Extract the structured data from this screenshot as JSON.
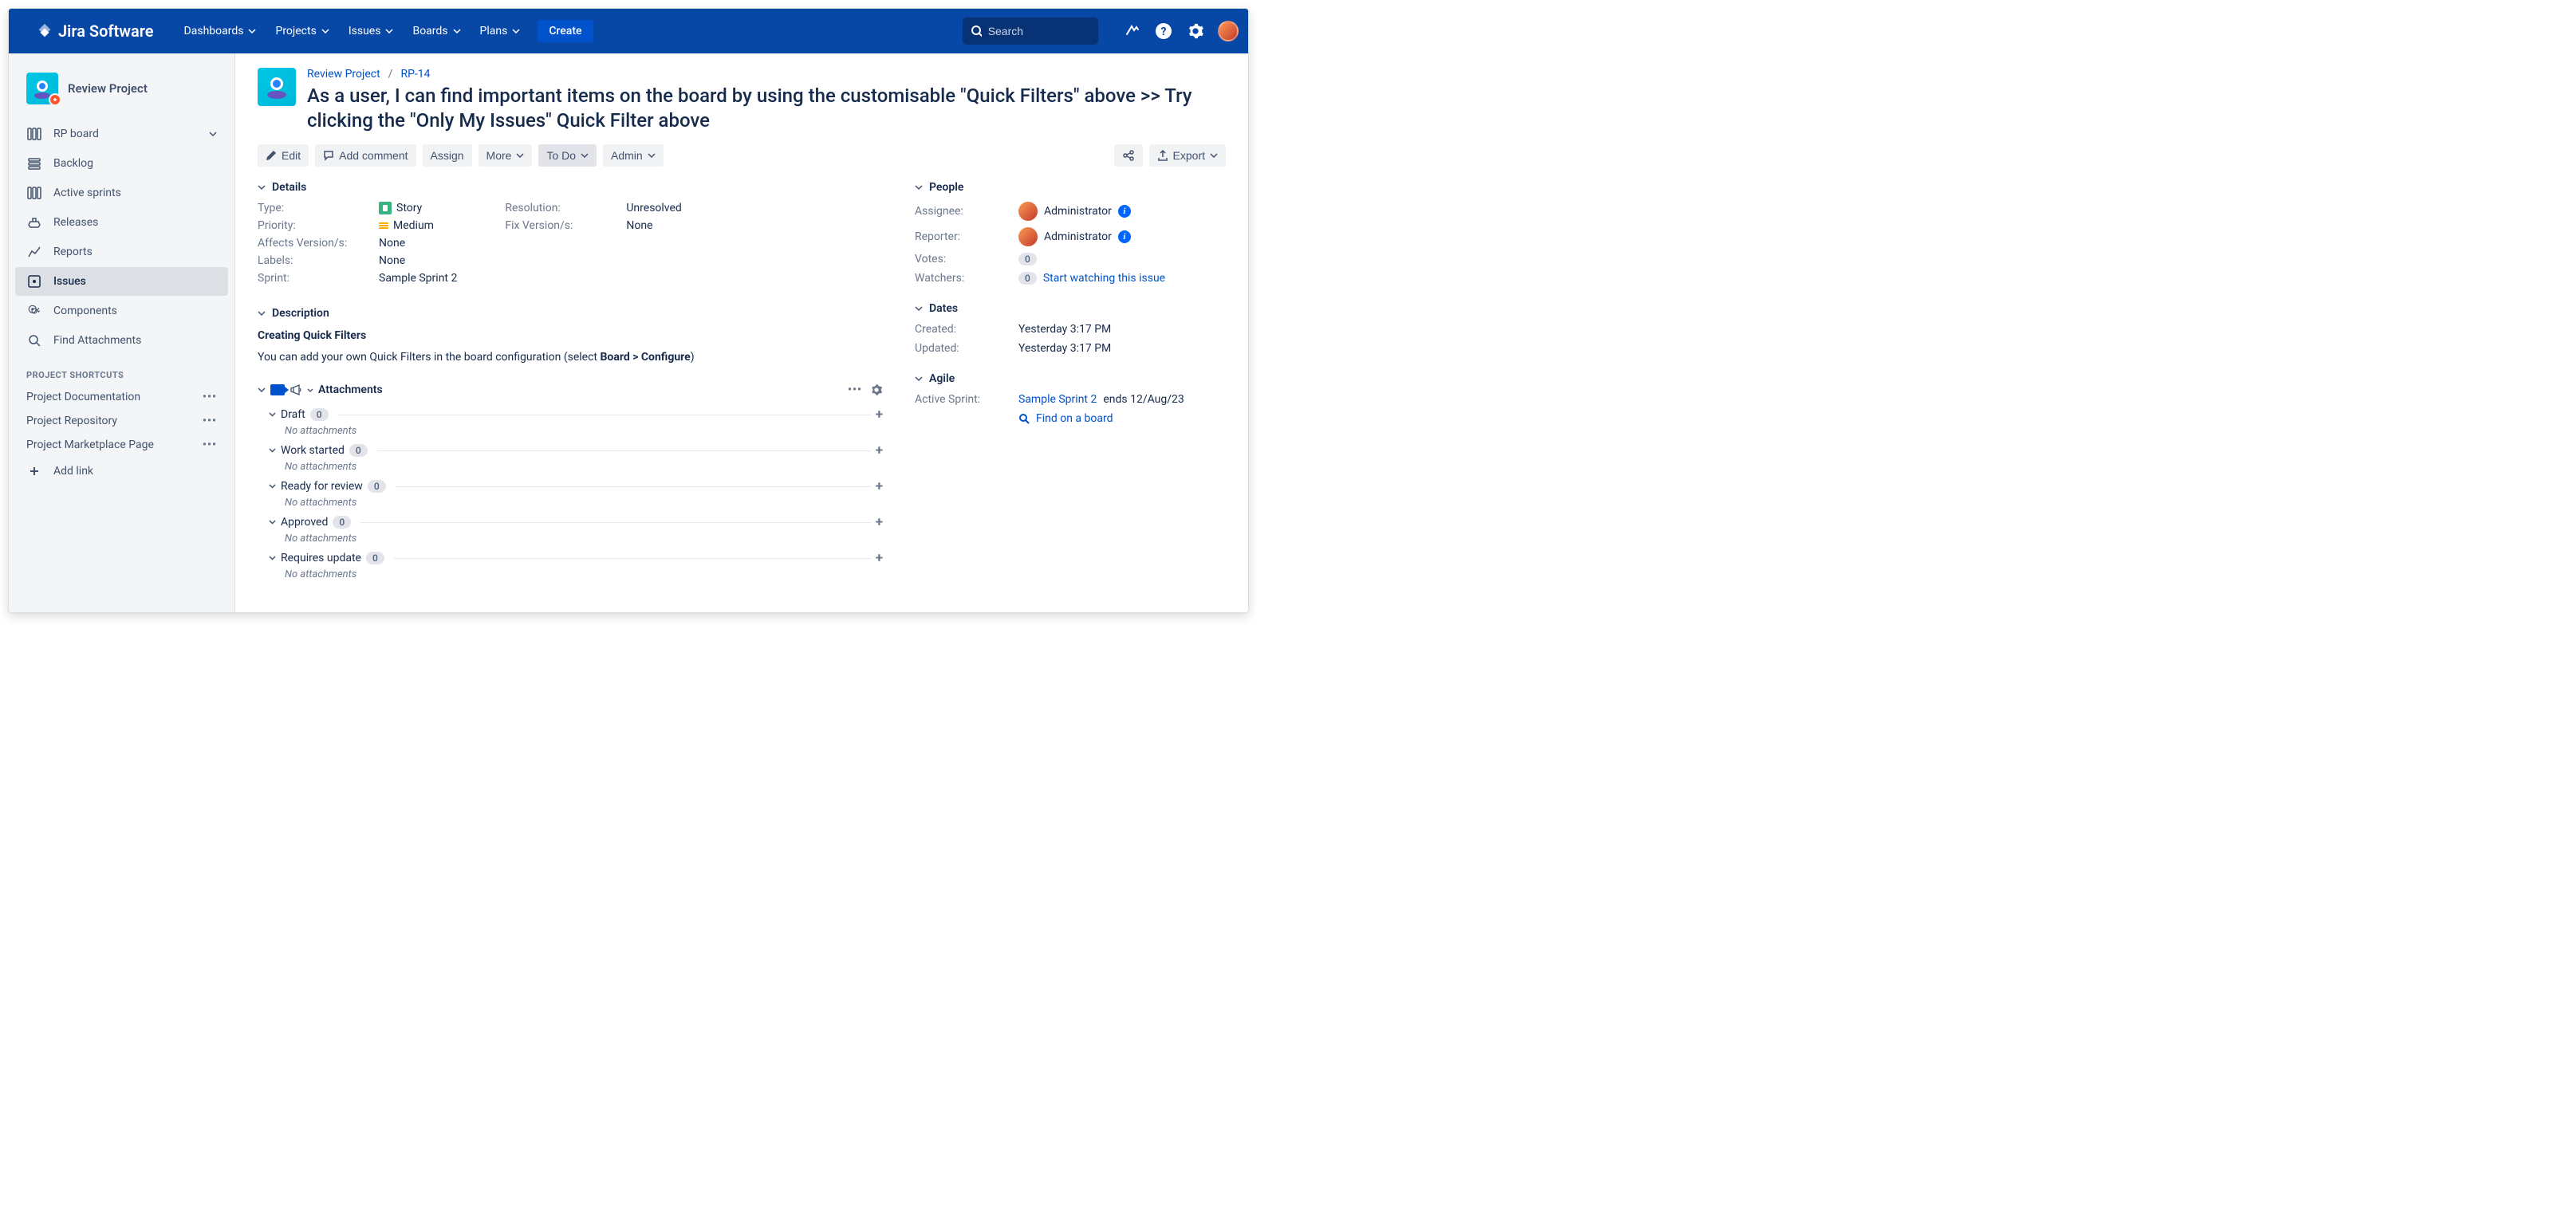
{
  "nav": {
    "logo": "Jira Software",
    "items": [
      "Dashboards",
      "Projects",
      "Issues",
      "Boards",
      "Plans"
    ],
    "create": "Create",
    "search_placeholder": "Search"
  },
  "sidebar": {
    "project_name": "Review Project",
    "items": [
      {
        "label": "RP board",
        "icon": "board",
        "expandable": true
      },
      {
        "label": "Backlog",
        "icon": "backlog"
      },
      {
        "label": "Active sprints",
        "icon": "sprints"
      },
      {
        "label": "Releases",
        "icon": "ship"
      },
      {
        "label": "Reports",
        "icon": "chart"
      },
      {
        "label": "Issues",
        "icon": "issues",
        "active": true
      },
      {
        "label": "Components",
        "icon": "component"
      },
      {
        "label": "Find Attachments",
        "icon": "search"
      }
    ],
    "shortcuts_heading": "PROJECT SHORTCUTS",
    "shortcuts": [
      "Project Documentation",
      "Project Repository",
      "Project Marketplace Page"
    ],
    "add_link": "Add link"
  },
  "issue": {
    "breadcrumb_project": "Review Project",
    "breadcrumb_key": "RP-14",
    "summary": "As a user, I can find important items on the board by using the customisable \"Quick Filters\" above >> Try clicking the \"Only My Issues\" Quick Filter above"
  },
  "toolbar": {
    "edit": "Edit",
    "comment": "Add comment",
    "assign": "Assign",
    "more": "More",
    "status": "To Do",
    "admin": "Admin",
    "export": "Export"
  },
  "details": {
    "title": "Details",
    "type_label": "Type:",
    "type_value": "Story",
    "priority_label": "Priority:",
    "priority_value": "Medium",
    "affects_label": "Affects Version/s:",
    "affects_value": "None",
    "labels_label": "Labels:",
    "labels_value": "None",
    "sprint_label": "Sprint:",
    "sprint_value": "Sample Sprint 2",
    "resolution_label": "Resolution:",
    "resolution_value": "Unresolved",
    "fix_label": "Fix Version/s:",
    "fix_value": "None"
  },
  "description": {
    "title": "Description",
    "heading": "Creating Quick Filters",
    "text_before": "You can add your own Quick Filters in the board configuration (select ",
    "text_bold": "Board > Configure",
    "text_after": ")"
  },
  "attachments": {
    "title": "Attachments",
    "sections": [
      {
        "name": "Draft",
        "count": "0",
        "empty": "No attachments"
      },
      {
        "name": "Work started",
        "count": "0",
        "empty": "No attachments"
      },
      {
        "name": "Ready for review",
        "count": "0",
        "empty": "No attachments"
      },
      {
        "name": "Approved",
        "count": "0",
        "empty": "No attachments"
      },
      {
        "name": "Requires update",
        "count": "0",
        "empty": "No attachments"
      }
    ]
  },
  "people": {
    "title": "People",
    "assignee_label": "Assignee:",
    "assignee_value": "Administrator",
    "reporter_label": "Reporter:",
    "reporter_value": "Administrator",
    "votes_label": "Votes:",
    "votes_value": "0",
    "watchers_label": "Watchers:",
    "watchers_value": "0",
    "watch_link": "Start watching this issue"
  },
  "dates": {
    "title": "Dates",
    "created_label": "Created:",
    "created_value": "Yesterday 3:17 PM",
    "updated_label": "Updated:",
    "updated_value": "Yesterday 3:17 PM"
  },
  "agile": {
    "title": "Agile",
    "sprint_label": "Active Sprint:",
    "sprint_link": "Sample Sprint 2",
    "sprint_suffix": " ends 12/Aug/23",
    "find_link": "Find on a board"
  }
}
